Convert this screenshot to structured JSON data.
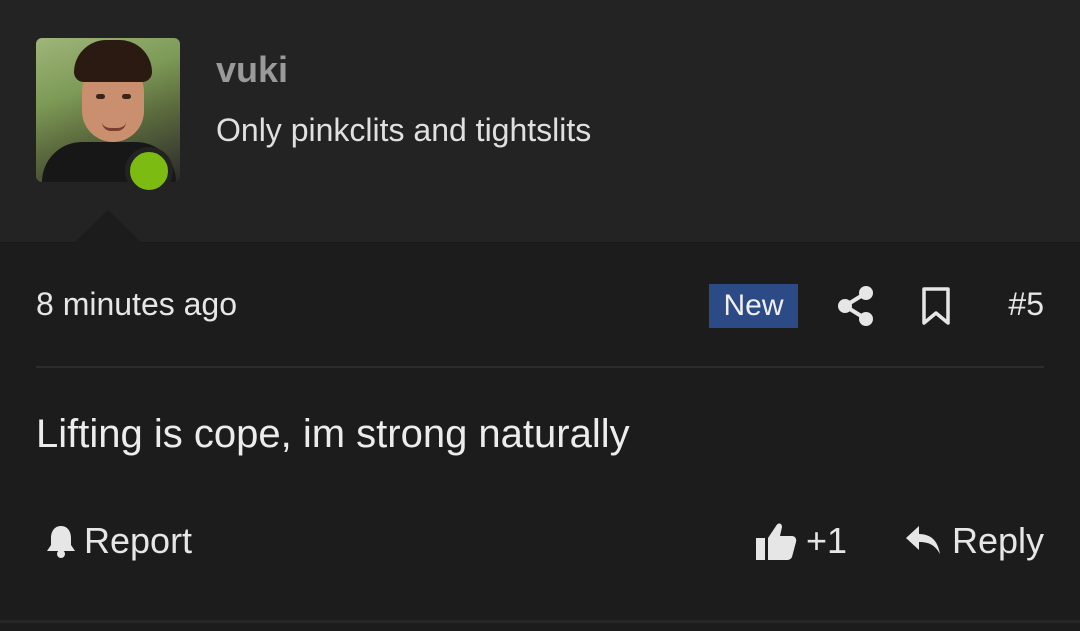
{
  "user": {
    "name": "vuki",
    "title": "Only pinkclits and tightslits",
    "online_color": "#7cbb12"
  },
  "post": {
    "timestamp": "8 minutes ago",
    "badge": "New",
    "badge_color": "#2b4a86",
    "number": "#5",
    "body": "Lifting is cope, im strong naturally"
  },
  "actions": {
    "report_label": "Report",
    "like_count": "+1",
    "reply_label": "Reply"
  },
  "icons": {
    "share": "share-icon",
    "bookmark": "bookmark-icon",
    "report": "bell-icon",
    "like": "thumbs-up-icon",
    "reply": "reply-arrow-icon"
  }
}
